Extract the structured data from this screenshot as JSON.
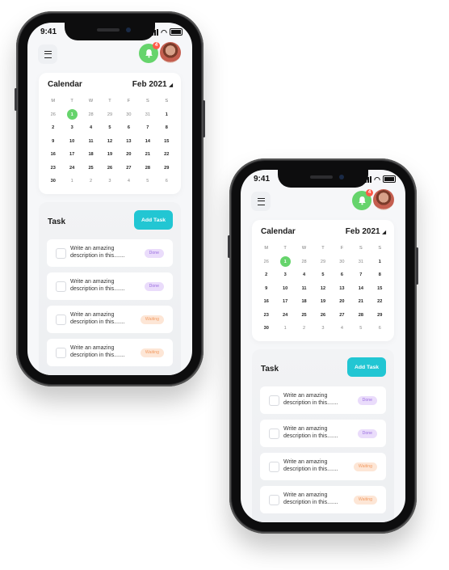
{
  "status": {
    "time": "9:41"
  },
  "notifications": {
    "count": "4"
  },
  "calendar": {
    "title": "Calendar",
    "month": "Feb 2021",
    "weekdays": [
      "M",
      "T",
      "W",
      "T",
      "F",
      "S",
      "S"
    ],
    "days": [
      {
        "d": "26",
        "muted": true
      },
      {
        "d": "1",
        "selected": true
      },
      {
        "d": "28",
        "muted": true
      },
      {
        "d": "29",
        "muted": true
      },
      {
        "d": "30",
        "muted": true
      },
      {
        "d": "31",
        "muted": true
      },
      {
        "d": "1"
      },
      {
        "d": "2"
      },
      {
        "d": "3"
      },
      {
        "d": "4"
      },
      {
        "d": "5"
      },
      {
        "d": "6"
      },
      {
        "d": "7"
      },
      {
        "d": "8"
      },
      {
        "d": "9"
      },
      {
        "d": "10"
      },
      {
        "d": "11"
      },
      {
        "d": "12"
      },
      {
        "d": "13"
      },
      {
        "d": "14"
      },
      {
        "d": "15"
      },
      {
        "d": "16"
      },
      {
        "d": "17"
      },
      {
        "d": "18"
      },
      {
        "d": "19"
      },
      {
        "d": "20"
      },
      {
        "d": "21"
      },
      {
        "d": "22"
      },
      {
        "d": "23"
      },
      {
        "d": "24"
      },
      {
        "d": "25"
      },
      {
        "d": "26"
      },
      {
        "d": "27"
      },
      {
        "d": "28"
      },
      {
        "d": "29"
      },
      {
        "d": "30"
      },
      {
        "d": "1",
        "muted": true
      },
      {
        "d": "2",
        "muted": true
      },
      {
        "d": "3",
        "muted": true
      },
      {
        "d": "4",
        "muted": true
      },
      {
        "d": "5",
        "muted": true
      },
      {
        "d": "6",
        "muted": true
      }
    ],
    "days_back": [
      {
        "d": "26",
        "muted": true
      },
      {
        "d": "1",
        "selected": true
      },
      {
        "d": "28",
        "muted": true
      },
      {
        "d": "29",
        "muted": true
      },
      {
        "d": "30",
        "muted": true
      },
      {
        "d": "31",
        "muted": true
      },
      {
        "d": "1"
      },
      {
        "d": "2"
      },
      {
        "d": "3"
      },
      {
        "d": "4"
      },
      {
        "d": "5"
      },
      {
        "d": "6"
      },
      {
        "d": "7"
      },
      {
        "d": "8"
      },
      {
        "d": "9"
      },
      {
        "d": "10"
      },
      {
        "d": "11"
      },
      {
        "d": "12"
      },
      {
        "d": "13"
      },
      {
        "d": "14"
      },
      {
        "d": "15"
      },
      {
        "d": "16"
      },
      {
        "d": "17"
      },
      {
        "d": "18"
      },
      {
        "d": "19"
      },
      {
        "d": "20"
      },
      {
        "d": "21"
      },
      {
        "d": "22"
      },
      {
        "d": "23"
      },
      {
        "d": "24"
      },
      {
        "d": "25"
      },
      {
        "d": "26"
      },
      {
        "d": "27"
      },
      {
        "d": "28"
      },
      {
        "d": "29"
      },
      {
        "d": "30"
      },
      {
        "d": "1",
        "muted": true
      },
      {
        "d": "2",
        "muted": true
      },
      {
        "d": "3",
        "muted": true
      },
      {
        "d": "4",
        "muted": true
      },
      {
        "d": "5",
        "muted": true
      },
      {
        "d": "6",
        "muted": true
      }
    ]
  },
  "tasks": {
    "title": "Task",
    "add_label": "Add Task",
    "items": [
      {
        "text": "Write an amazing description in this.......",
        "status": "Done",
        "kind": "done"
      },
      {
        "text": "Write an amazing description in this.......",
        "status": "Done",
        "kind": "done"
      },
      {
        "text": "Write an amazing description in this.......",
        "status": "Waiting",
        "kind": "waiting"
      },
      {
        "text": "Write an amazing description in this.......",
        "status": "Waiting",
        "kind": "waiting"
      }
    ]
  },
  "colors": {
    "accent_green": "#66d46c",
    "accent_teal": "#22c6d3",
    "done_purple": "#9a6ee0",
    "waiting_orange": "#f29b62"
  }
}
